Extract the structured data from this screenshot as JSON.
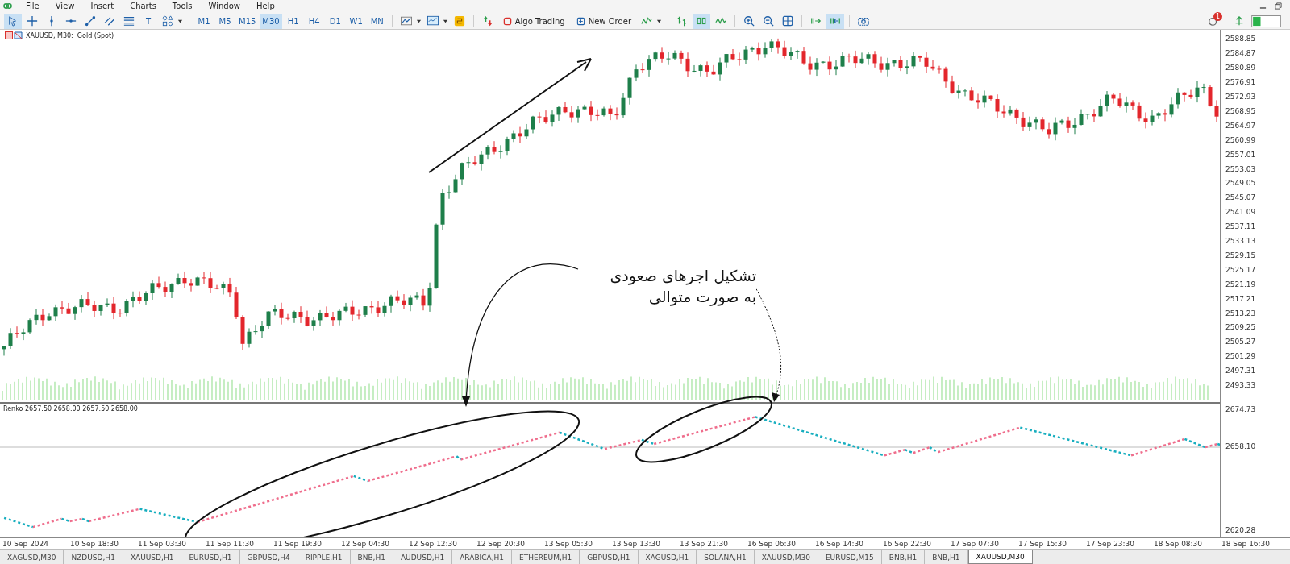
{
  "menu": [
    "File",
    "View",
    "Insert",
    "Charts",
    "Tools",
    "Window",
    "Help"
  ],
  "drawing_tools": [
    {
      "kind": "cursor",
      "selected": true
    },
    {
      "kind": "crosshair",
      "selected": false
    },
    {
      "kind": "vline",
      "selected": false
    },
    {
      "kind": "hline",
      "selected": false
    },
    {
      "kind": "trendline",
      "selected": false
    },
    {
      "kind": "channel",
      "selected": false
    },
    {
      "kind": "fibo",
      "selected": false
    },
    {
      "kind": "text",
      "label": "T",
      "selected": false
    },
    {
      "kind": "shapes",
      "selected": false
    }
  ],
  "timeframes": [
    {
      "label": "M1",
      "selected": false
    },
    {
      "label": "M5",
      "selected": false
    },
    {
      "label": "M15",
      "selected": false
    },
    {
      "label": "M30",
      "selected": true
    },
    {
      "label": "H1",
      "selected": false
    },
    {
      "label": "H4",
      "selected": false
    },
    {
      "label": "D1",
      "selected": false
    },
    {
      "label": "W1",
      "selected": false
    },
    {
      "label": "MN",
      "selected": false
    }
  ],
  "buttons": [
    {
      "kind": "algo",
      "label": "Algo Trading"
    },
    {
      "kind": "order",
      "label": "New Order"
    }
  ],
  "view_tools": [
    {
      "kind": "bars",
      "selected": false
    },
    {
      "kind": "candles",
      "selected": true
    },
    {
      "kind": "line",
      "selected": false
    },
    {
      "kind": "zoom-in",
      "selected": false
    },
    {
      "kind": "zoom-out",
      "selected": false
    },
    {
      "kind": "grid",
      "selected": false
    },
    {
      "kind": "autoscroll",
      "selected": false
    },
    {
      "kind": "shift",
      "selected": true
    },
    {
      "kind": "screenshot",
      "selected": false
    }
  ],
  "notifications": {
    "count": "1"
  },
  "chart": {
    "title": "XAUUSD, M30:  Gold (Spot)",
    "price_labels": [
      "2588.85",
      "2584.87",
      "2580.89",
      "2576.91",
      "2572.93",
      "2568.95",
      "2564.97",
      "2560.99",
      "2557.01",
      "2553.03",
      "2549.05",
      "2545.07",
      "2541.09",
      "2537.11",
      "2533.13",
      "2529.15",
      "2525.17",
      "2521.19",
      "2517.21",
      "2513.23",
      "2509.25",
      "2505.27",
      "2501.29",
      "2497.31",
      "2493.33"
    ],
    "indicator": {
      "label": "Renko 2657.50 2658.00 2657.50 2658.00",
      "price_labels": [
        "2674.73",
        "2658.10",
        "2620.28"
      ]
    },
    "time_labels": [
      "10 Sep 2024",
      "10 Sep 18:30",
      "11 Sep 03:30",
      "11 Sep 11:30",
      "11 Sep 19:30",
      "12 Sep 04:30",
      "12 Sep 12:30",
      "12 Sep 20:30",
      "13 Sep 05:30",
      "13 Sep 13:30",
      "13 Sep 21:30",
      "16 Sep 06:30",
      "16 Sep 14:30",
      "16 Sep 22:30",
      "17 Sep 07:30",
      "17 Sep 15:30",
      "17 Sep 23:30",
      "18 Sep 08:30",
      "18 Sep 16:30"
    ]
  },
  "annotation": {
    "lines": [
      "تشکیل اجرهای صعودی",
      "به صورت متوالی"
    ]
  },
  "tabs": [
    {
      "label": "XAGUSD,M30",
      "selected": false
    },
    {
      "label": "NZDUSD,H1",
      "selected": false
    },
    {
      "label": "XAUUSD,H1",
      "selected": false
    },
    {
      "label": "EURUSD,H1",
      "selected": false
    },
    {
      "label": "GBPUSD,H4",
      "selected": false
    },
    {
      "label": "RIPPLE,H1",
      "selected": false
    },
    {
      "label": "BNB,H1",
      "selected": false
    },
    {
      "label": "AUDUSD,H1",
      "selected": false
    },
    {
      "label": "ARABICA,H1",
      "selected": false
    },
    {
      "label": "ETHEREUM,H1",
      "selected": false
    },
    {
      "label": "GBPUSD,H1",
      "selected": false
    },
    {
      "label": "XAGUSD,H1",
      "selected": false
    },
    {
      "label": "SOLANA,H1",
      "selected": false
    },
    {
      "label": "XAUUSD,M30",
      "selected": false
    },
    {
      "label": "EURUSD,M15",
      "selected": false
    },
    {
      "label": "BNB,H1",
      "selected": false
    },
    {
      "label": "BNB,H1",
      "selected": false
    },
    {
      "label": "XAUUSD,M30",
      "selected": true
    }
  ]
}
